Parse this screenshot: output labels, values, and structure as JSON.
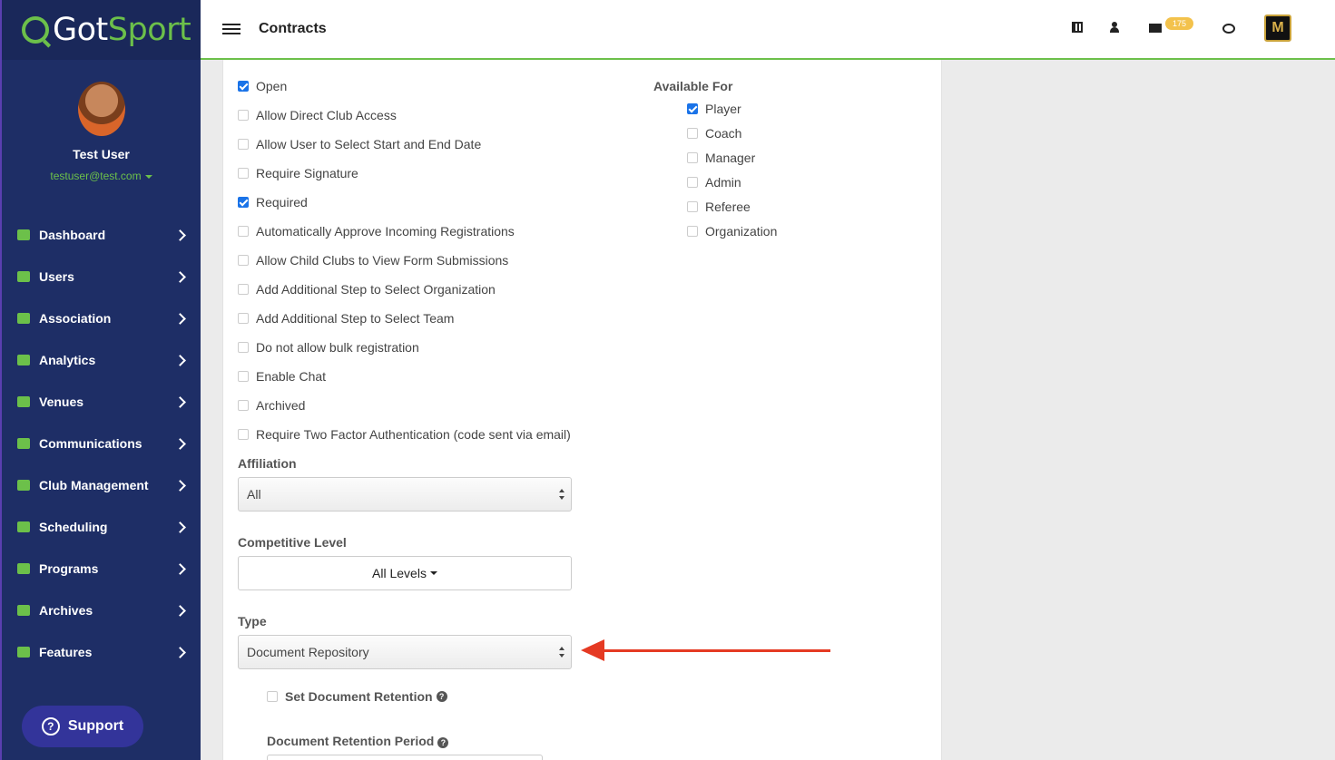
{
  "app": {
    "logo_got": "Got",
    "logo_sport": "Sport"
  },
  "profile": {
    "name": "Test User",
    "email": "testuser@test.com"
  },
  "sidebar": {
    "items": [
      {
        "label": "Dashboard",
        "icon": "dashboard-icon"
      },
      {
        "label": "Users",
        "icon": "users-icon"
      },
      {
        "label": "Association",
        "icon": "sitemap-icon"
      },
      {
        "label": "Analytics",
        "icon": "chart-icon"
      },
      {
        "label": "Venues",
        "icon": "home-icon"
      },
      {
        "label": "Communications",
        "icon": "chat-icon"
      },
      {
        "label": "Club Management",
        "icon": "list-icon"
      },
      {
        "label": "Scheduling",
        "icon": "calendar-icon"
      },
      {
        "label": "Programs",
        "icon": "document-icon"
      },
      {
        "label": "Archives",
        "icon": "archive-icon"
      },
      {
        "label": "Features",
        "icon": "star-icon"
      }
    ],
    "support_label": "Support"
  },
  "header": {
    "title": "Contracts",
    "mail_count": "175",
    "org_logo_letter": "M"
  },
  "form": {
    "options": [
      {
        "label": "Open",
        "checked": true
      },
      {
        "label": "Allow Direct Club Access",
        "checked": false
      },
      {
        "label": "Allow User to Select Start and End Date",
        "checked": false
      },
      {
        "label": "Require Signature",
        "checked": false
      },
      {
        "label": "Required",
        "checked": true
      },
      {
        "label": "Automatically Approve Incoming Registrations",
        "checked": false
      },
      {
        "label": "Allow Child Clubs to View Form Submissions",
        "checked": false
      },
      {
        "label": "Add Additional Step to Select Organization",
        "checked": false
      },
      {
        "label": "Add Additional Step to Select Team",
        "checked": false
      },
      {
        "label": "Do not allow bulk registration",
        "checked": false
      },
      {
        "label": "Enable Chat",
        "checked": false
      },
      {
        "label": "Archived",
        "checked": false
      },
      {
        "label": "Require Two Factor Authentication (code sent via email)",
        "checked": false
      }
    ],
    "available_for_label": "Available For",
    "available_for": [
      {
        "label": "Player",
        "checked": true
      },
      {
        "label": "Coach",
        "checked": false
      },
      {
        "label": "Manager",
        "checked": false
      },
      {
        "label": "Admin",
        "checked": false
      },
      {
        "label": "Referee",
        "checked": false
      },
      {
        "label": "Organization",
        "checked": false
      }
    ],
    "affiliation_label": "Affiliation",
    "affiliation_value": "All",
    "competitive_level_label": "Competitive Level",
    "competitive_level_value": "All Levels",
    "type_label": "Type",
    "type_value": "Document Repository",
    "set_retention_label": "Set Document Retention",
    "set_retention_checked": false,
    "retention_period_label": "Document Retention Period"
  },
  "colors": {
    "brand_green": "#6cc04a",
    "sidebar_bg": "#1e2e66",
    "annotation_red": "#e53a23",
    "checkbox_blue": "#1a73e8"
  }
}
